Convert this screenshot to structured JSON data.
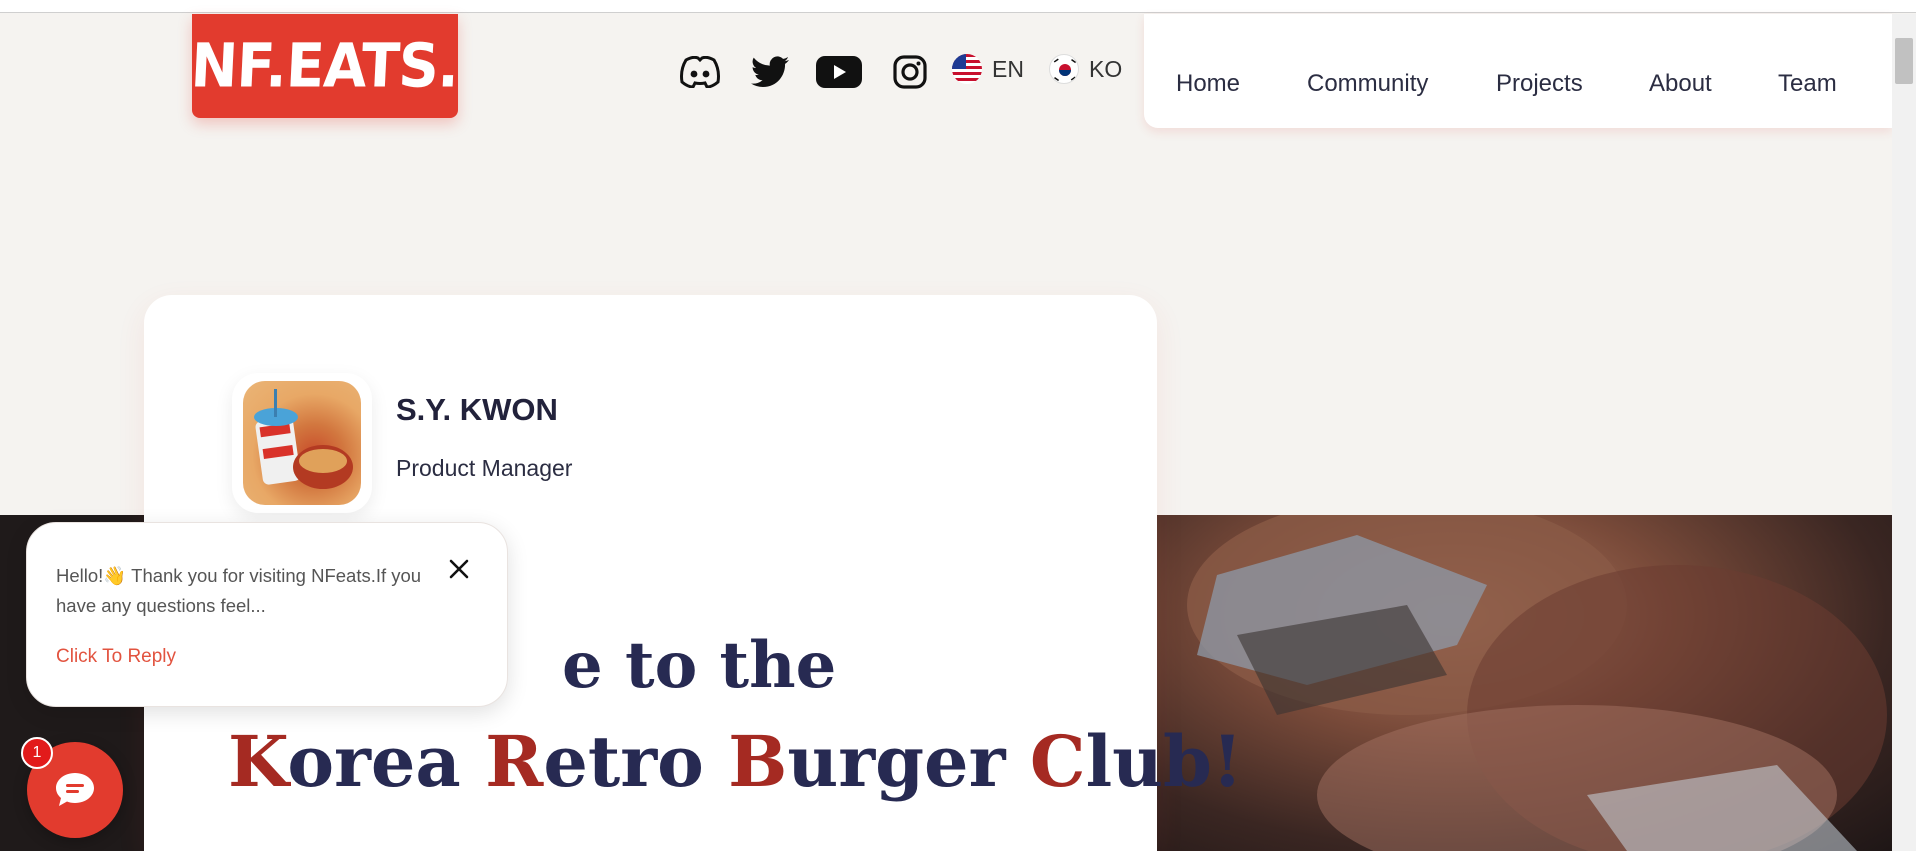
{
  "logo": {
    "text": "NF.EATS."
  },
  "social": {
    "icons": [
      "discord-icon",
      "twitter-icon",
      "youtube-icon",
      "instagram-icon"
    ]
  },
  "languages": [
    {
      "code": "EN",
      "flag": "us-flag-icon"
    },
    {
      "code": "KO",
      "flag": "kr-flag-icon"
    }
  ],
  "nav": {
    "items": [
      {
        "label": "Home"
      },
      {
        "label": "Community"
      },
      {
        "label": "Projects"
      },
      {
        "label": "About"
      },
      {
        "label": "Team"
      }
    ]
  },
  "profile": {
    "name": "S.Y. KWON",
    "role": "Product Manager"
  },
  "hero": {
    "line1_visible": "e to the",
    "line2_parts": [
      {
        "text": "K",
        "accent": true
      },
      {
        "text": "orea ",
        "accent": false
      },
      {
        "text": "R",
        "accent": true
      },
      {
        "text": "etro ",
        "accent": false
      },
      {
        "text": "B",
        "accent": true
      },
      {
        "text": "urger ",
        "accent": false
      },
      {
        "text": "C",
        "accent": true
      },
      {
        "text": "lub!",
        "accent": false
      }
    ]
  },
  "chat": {
    "message": "Hello!👋 Thank you for visiting NFeats.If you have any questions feel...",
    "reply_label": "Click To Reply",
    "badge_count": "1"
  },
  "colors": {
    "brand_red": "#e23b2e",
    "accent_dark_red": "#a52a22",
    "heading_navy": "#272a52",
    "page_bg": "#f5f3f0"
  }
}
